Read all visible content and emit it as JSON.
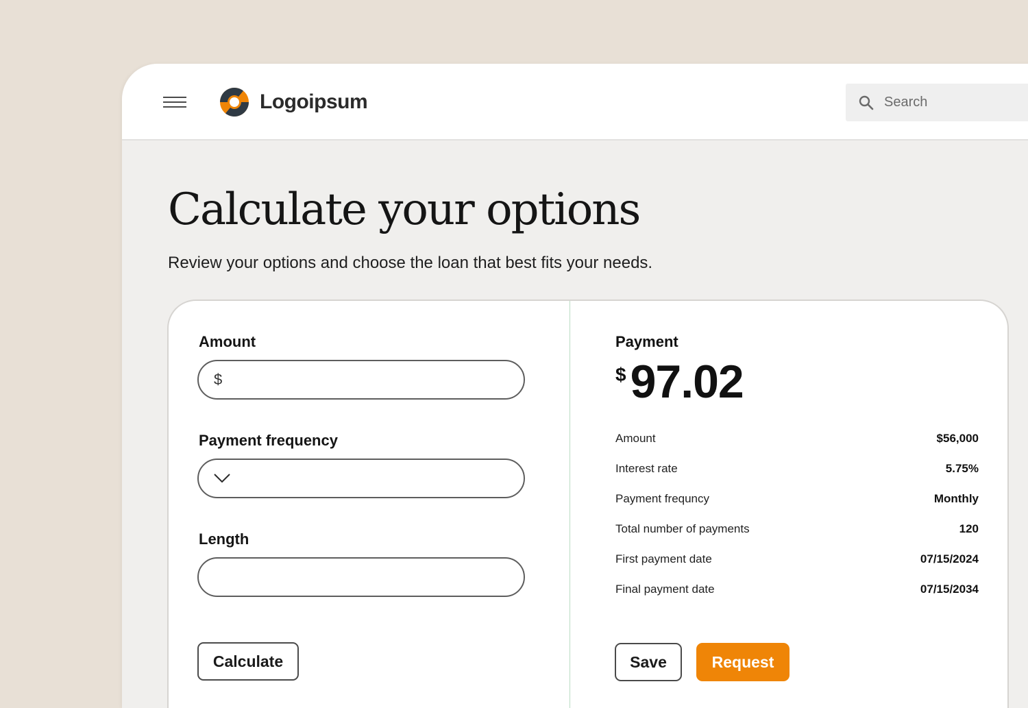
{
  "header": {
    "logo_text": "Logoipsum",
    "search": {
      "placeholder": "Search"
    }
  },
  "page": {
    "title": "Calculate your options",
    "subtitle": "Review your options and choose the loan that best fits your needs."
  },
  "form": {
    "amount": {
      "label": "Amount",
      "prefix": "$",
      "value": ""
    },
    "frequency": {
      "label": "Payment frequency",
      "value": ""
    },
    "length": {
      "label": "Length",
      "value": ""
    },
    "calculate_label": "Calculate"
  },
  "summary": {
    "payment_label": "Payment",
    "currency": "$",
    "payment_amount": "97.02",
    "rows": [
      {
        "label": "Amount",
        "value": "$56,000"
      },
      {
        "label": "Interest rate",
        "value": "5.75%"
      },
      {
        "label": "Payment frequncy",
        "value": "Monthly"
      },
      {
        "label": "Total number of payments",
        "value": "120"
      },
      {
        "label": "First payment date",
        "value": "07/15/2024"
      },
      {
        "label": "Final payment date",
        "value": "07/15/2034"
      }
    ],
    "save_label": "Save",
    "request_label": "Request"
  },
  "colors": {
    "accent": "#ef8507",
    "background": "#e8e0d6",
    "panel": "#f0efed",
    "divider": "#b9dcc3"
  },
  "icons": [
    "menu-icon",
    "logo-icon",
    "search-icon",
    "chevron-down-icon"
  ]
}
